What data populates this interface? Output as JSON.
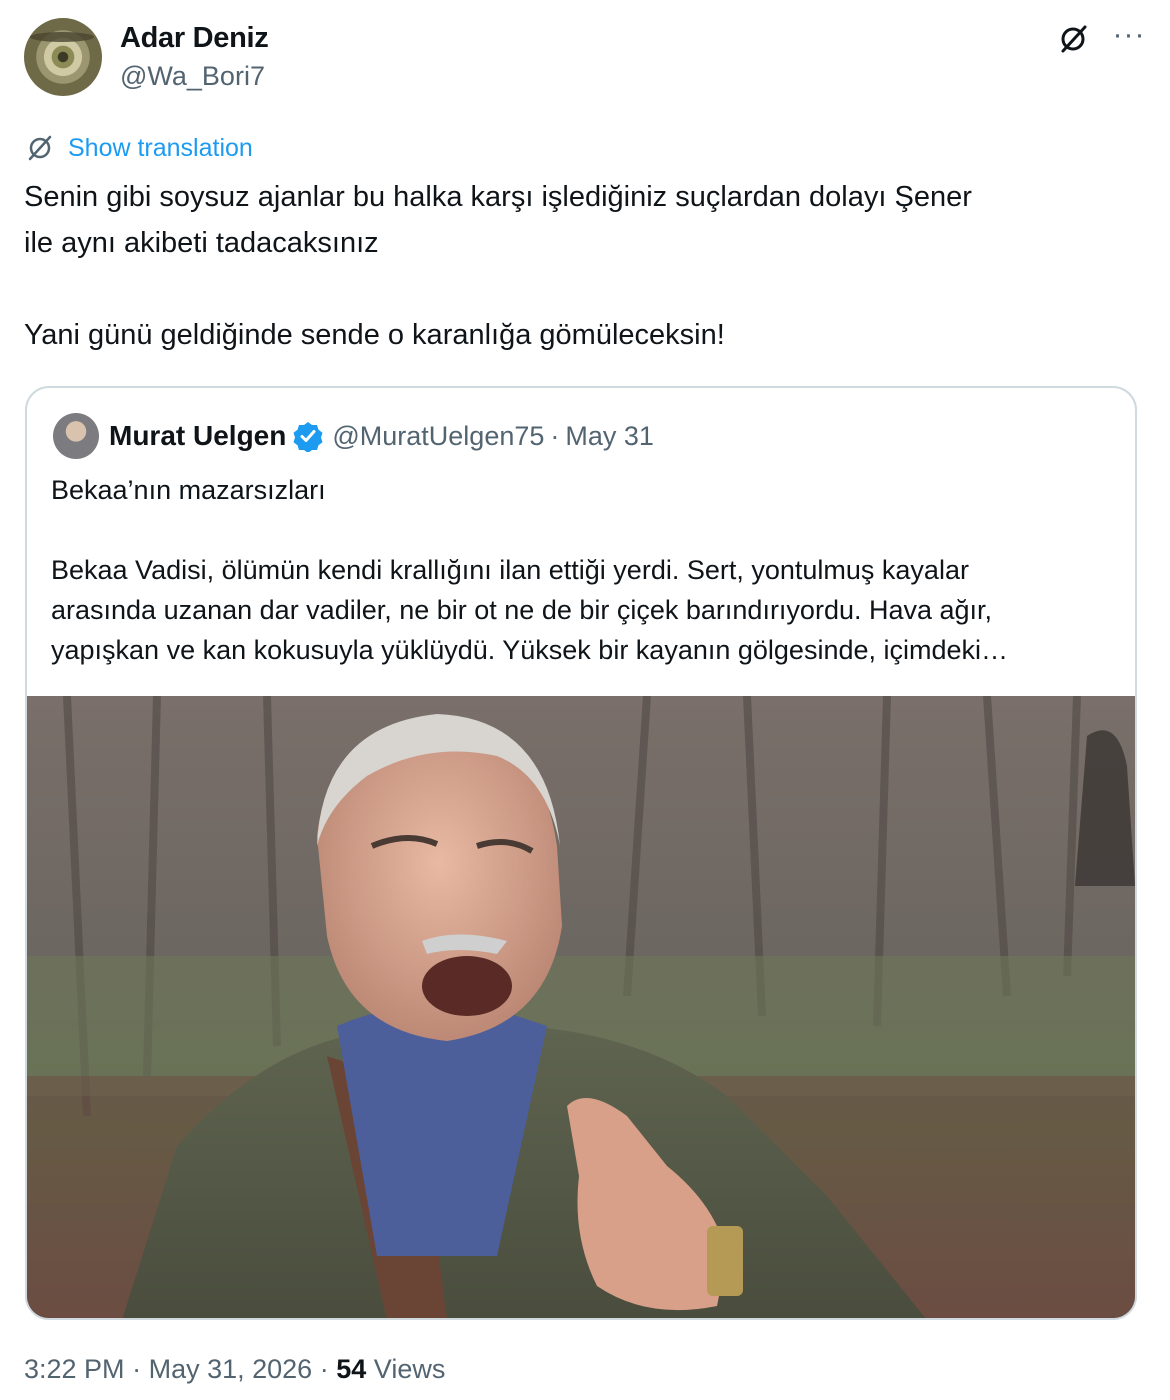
{
  "author": {
    "name": "Adar Deniz",
    "handle": "@Wa_Bori7"
  },
  "translation_link": "Show translation",
  "tweet": {
    "text": "Senin gibi soysuz ajanlar bu halka karşı işlediğiniz suçlardan dolayı Şener\nile aynı akibeti tadacaksınız\n\nYani günü geldiğinde sende o karanlığa gömüleceksin!"
  },
  "quoted": {
    "name": "Murat Uelgen",
    "handle": "@MuratUelgen75",
    "separator": "·",
    "date": "May 31",
    "text": "Bekaa’nın mazarsızları\n\nBekaa Vadisi, ölümün kendi krallığını ilan ettiği yerdi. Sert, yontulmuş kayalar\narasında uzanan dar vadiler, ne bir ot ne de bir çiçek barındırıyordu. Hava ağır,\nyapışkan ve kan kokusuyla yüklüydü. Yüksek bir kayanın gölgesinde, içimdeki…"
  },
  "meta": {
    "time": "3:22 PM",
    "separator": "·",
    "date": "May 31, 2026",
    "views_count": "54",
    "views_label": "Views"
  },
  "colors": {
    "link": "#1d9bf0",
    "secondary_text": "#536471",
    "border": "#cfd9de",
    "verified": "#1d9bf0"
  },
  "icons": [
    "grok-icon",
    "more-icon",
    "translate-icon",
    "verified-badge-icon"
  ]
}
